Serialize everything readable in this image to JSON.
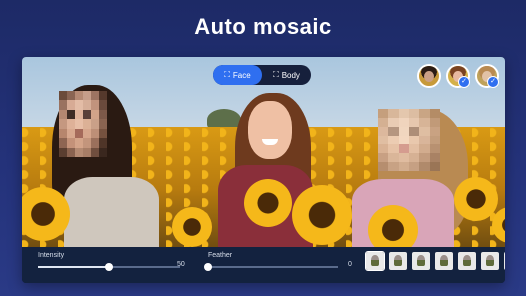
{
  "headline": "Auto mosaic",
  "toggle": {
    "face_label": "Face",
    "body_label": "Body",
    "selected": "Face"
  },
  "avatars": [
    {
      "name": "face-1",
      "checked": false
    },
    {
      "name": "face-2",
      "checked": true
    },
    {
      "name": "face-3",
      "checked": true
    }
  ],
  "controls": {
    "intensity": {
      "label": "Intensity",
      "value": "50",
      "fraction": 0.5
    },
    "feather": {
      "label": "Feather",
      "value": "0",
      "fraction": 0.0
    }
  },
  "thumbnails_count": 7,
  "colors": {
    "accent": "#2f6ff0",
    "panel": "#13223f",
    "background": "#1d2a66"
  }
}
